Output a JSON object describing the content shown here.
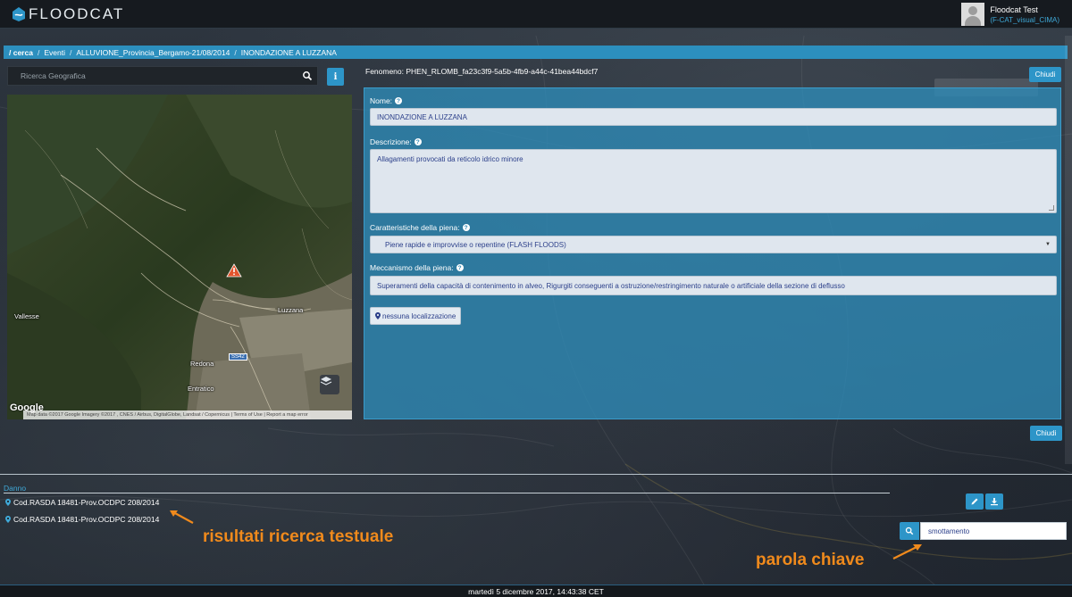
{
  "header": {
    "logo_text": "FLOODCAT",
    "user_name": "Floodcat Test",
    "user_role": "(F-CAT_visual_CIMA)"
  },
  "breadcrumb": [
    "/ cerca",
    "Eventi",
    "ALLUVIONE_Provincia_Bergamo-21/08/2014",
    "INONDAZIONE A LUZZANA"
  ],
  "map_panel": {
    "search_placeholder": "Ricerca Geografica",
    "info_label": "i",
    "labels": {
      "luzzana": "Luzzana",
      "vallesse": "Vallesse",
      "redona": "Redona",
      "entratico": "Entratico",
      "road": "SS42"
    },
    "google": "Google",
    "attribution": "Map data ©2017 Google Imagery ©2017 , CNES / Airbus, DigitalGlobe, Landsat / Copernicus  |  Terms of Use  |  Report a map error"
  },
  "detail": {
    "fenomeno": "Fenomeno: PHEN_RLOMB_fa23c3f9-5a5b-4fb9-a44c-41bea44bdcf7",
    "close_label": "Chiudi",
    "nome_label": "Nome:",
    "nome_value": "INONDAZIONE A LUZZANA",
    "descrizione_label": "Descrizione:",
    "descrizione_value": "Allagamenti provocati da reticolo idrico minore",
    "caratteristiche_label": "Caratteristiche della piena:",
    "caratteristiche_value": "Piene rapide e improvvise o repentine (FLASH FLOODS)",
    "meccanismo_label": "Meccanismo della piena:",
    "meccanismo_value": "Superamenti della capacità di contenimento in alveo,  Rigurgiti conseguenti a ostruzione/restringimento naturale o artificiale della sezione di deflusso",
    "localizzazione_label": "nessuna localizzazione"
  },
  "results": {
    "section_label": "Danno",
    "items": [
      "Cod.RASDA 18481-Prov.OCDPC 208/2014",
      "Cod.RASDA 18481-Prov.OCDPC 208/2014"
    ],
    "keyword_value": "smottamento"
  },
  "annotations": {
    "text_results": "risultati ricerca testuale",
    "keyword": "parola chiave"
  },
  "footer": {
    "datetime": "martedì 5 dicembre 2017, 14:43:38 CET"
  },
  "colors": {
    "accent": "#2d95c8",
    "panel": "#2e8cb9",
    "annotation": "#f08a1c",
    "link": "#3fa9d8"
  }
}
